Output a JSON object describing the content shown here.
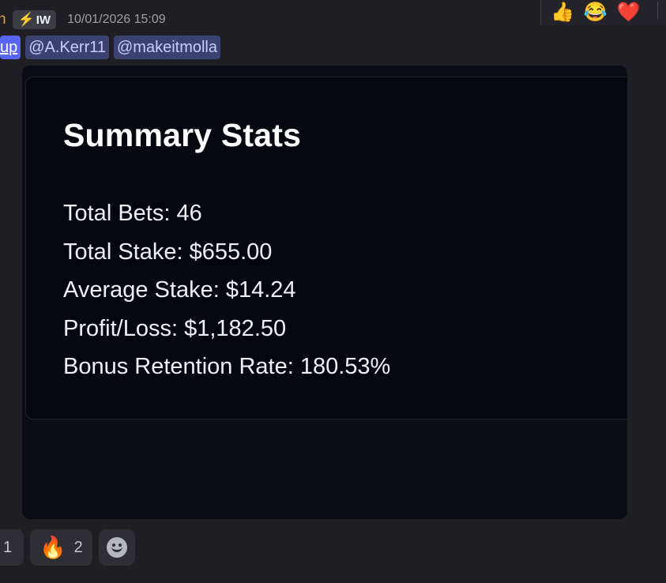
{
  "colors": {
    "background": "#1f1e23",
    "embed_background": "#05070f",
    "mention_background": "#3c4270",
    "mention_text": "#c9cdfb",
    "username": "#e6a13a"
  },
  "header": {
    "username_fragment": "n",
    "role_icon": "lightning-bolt-icon",
    "role_tag": "IW",
    "timestamp": "10/01/2026 15:09"
  },
  "reaction_toolbar": {
    "items": [
      {
        "icon": "thumbs-up-icon",
        "glyph": "👍"
      },
      {
        "icon": "tears-of-joy-icon",
        "glyph": "😂"
      },
      {
        "icon": "red-heart-icon",
        "glyph": "❤️"
      }
    ]
  },
  "mentions": [
    "up",
    "@A.Kerr11",
    "@makeitmolla"
  ],
  "embed": {
    "title": "Summary Stats",
    "stats": [
      "Total Bets: 46",
      "Total Stake: $655.00",
      "Average Stake: $14.24",
      "Profit/Loss: $1,182.50",
      "Bonus Retention Rate: 180.53%"
    ]
  },
  "reactions": [
    {
      "icon": "",
      "glyph": "",
      "count": "1"
    },
    {
      "icon": "fire-icon",
      "glyph": "🔥",
      "count": "2"
    }
  ],
  "add_reaction": {
    "icon": "add-reaction-smiley-icon"
  }
}
